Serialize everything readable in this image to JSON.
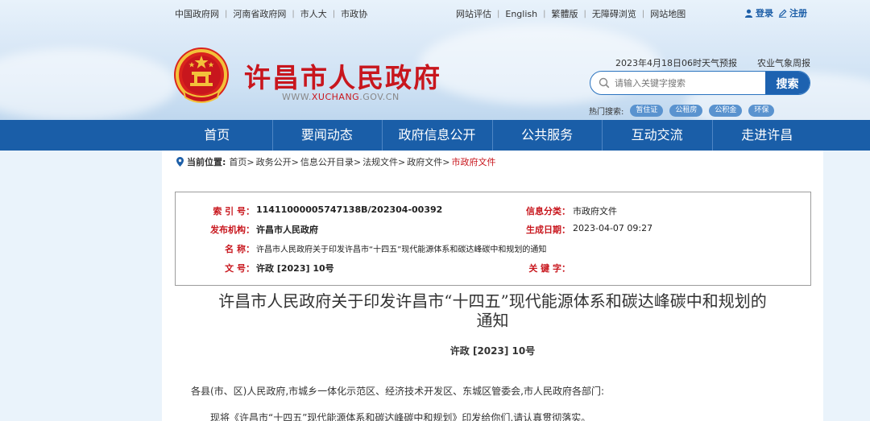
{
  "top_links_left": [
    "中国政府网",
    "河南省政府网",
    "市人大",
    "市政协"
  ],
  "top_links_right": [
    "网站评估",
    "English",
    "繁體版",
    "无障碍浏览",
    "网站地图"
  ],
  "login": {
    "login_label": "登录",
    "register_label": "注册"
  },
  "site": {
    "title": "许昌市人民政府",
    "url_prefix": "WWW.",
    "url_main": "XUCHANG",
    "url_suffix": ".GOV.CN"
  },
  "weather": {
    "forecast": "2023年4月18日06时天气预报",
    "agri": "农业气象周报"
  },
  "search": {
    "placeholder": "请输入关键字搜索",
    "button_label": "搜索"
  },
  "hot_search": {
    "label": "热门搜索:",
    "tags": [
      "暂住证",
      "公租房",
      "公积金",
      "环保"
    ]
  },
  "nav": [
    "首页",
    "要闻动态",
    "政府信息公开",
    "公共服务",
    "互动交流",
    "走进许昌"
  ],
  "breadcrumb": {
    "label": "当前位置:",
    "items": [
      "首页>",
      "政务公开>",
      "信息公开目录>",
      "法规文件>",
      "政府文件>"
    ],
    "current": "市政府文件"
  },
  "info": {
    "index_label": "索 引 号：",
    "index_value": "11411000005747138B/202304-00392",
    "category_label": "信息分类：",
    "category_value": "市政府文件",
    "publisher_label": "发布机构：",
    "publisher_value": "许昌市人民政府",
    "date_label": "生成日期：",
    "date_value": "2023-04-07 09:27",
    "name_label": "名 称：",
    "name_value": "许昌市人民政府关于印发许昌市“十四五”现代能源体系和碳达峰碳中和规划的通知",
    "docno_label": "文 号：",
    "docno_value": "许政 [2023] 10号",
    "keyword_label": "关 键 字：",
    "keyword_value": ""
  },
  "document": {
    "title_line1": "许昌市人民政府关于印发许昌市“十四五”现代能源体系和碳达峰碳中和规划的",
    "title_line2": "通知",
    "number": "许政 [2023] 10号",
    "para1": "各县(市、区)人民政府,市城乡一体化示范区、经济技术开发区、东城区管委会,市人民政府各部门:",
    "para2": "现将《许昌市“十四五”现代能源体系和碳达峰碳中和规划》印发给你们,请认真贯彻落实。"
  },
  "colors": {
    "brand_red": "#c8161d",
    "nav_blue": "#1a5ea8",
    "search_blue": "#1d62b0"
  }
}
